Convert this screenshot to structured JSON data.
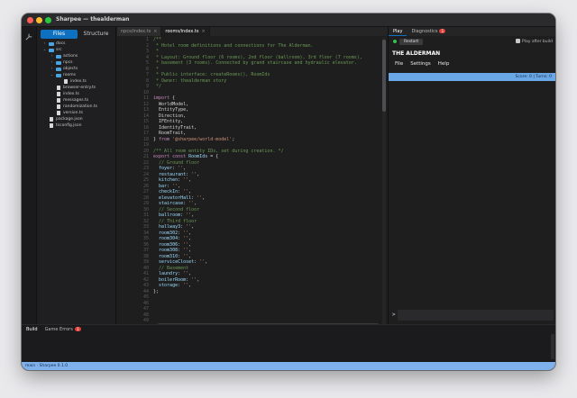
{
  "window": {
    "title": "Sharpee — thealderman"
  },
  "sidebar": {
    "tabs": [
      {
        "label": "Files"
      },
      {
        "label": "Structure"
      }
    ],
    "tree": [
      {
        "label": "docs",
        "type": "folder",
        "depth": 0,
        "expanded": false
      },
      {
        "label": "src",
        "type": "folder",
        "depth": 0,
        "expanded": true
      },
      {
        "label": "actions",
        "type": "folder",
        "depth": 1,
        "expanded": false
      },
      {
        "label": "npcs",
        "type": "folder",
        "depth": 1,
        "expanded": false
      },
      {
        "label": "objects",
        "type": "folder",
        "depth": 1,
        "expanded": false
      },
      {
        "label": "rooms",
        "type": "folder",
        "depth": 1,
        "expanded": true
      },
      {
        "label": "index.ts",
        "type": "file",
        "depth": 2
      },
      {
        "label": "browser-entry.ts",
        "type": "file",
        "depth": 1
      },
      {
        "label": "index.ts",
        "type": "file",
        "depth": 1
      },
      {
        "label": "messages.ts",
        "type": "file",
        "depth": 1
      },
      {
        "label": "randomization.ts",
        "type": "file",
        "depth": 1
      },
      {
        "label": "version.ts",
        "type": "file",
        "depth": 1
      },
      {
        "label": "package.json",
        "type": "file",
        "depth": 0
      },
      {
        "label": "tsconfig.json",
        "type": "file",
        "depth": 0
      }
    ]
  },
  "editor": {
    "tabs": [
      {
        "label": "npcs/index.ts",
        "active": false
      },
      {
        "label": "rooms/index.ts",
        "active": true
      }
    ],
    "line_numbers": [
      "1",
      "2",
      "3",
      "4",
      "5",
      "6",
      "7",
      "8",
      "9",
      "10",
      "11",
      "12",
      "13",
      "14",
      "15",
      "16",
      "17",
      "18",
      "19",
      "20",
      "21",
      "22",
      "23",
      "24",
      "25",
      "26",
      "27",
      "28",
      "29",
      "30",
      "31",
      "32",
      "33",
      "34",
      "35",
      "36",
      "37",
      "38",
      "39",
      "40",
      "41",
      "42",
      "43",
      "44",
      "45",
      "46",
      "47",
      "48",
      "49"
    ],
    "lines": [
      [
        {
          "t": "c",
          "s": "/**"
        }
      ],
      [
        {
          "t": "c",
          "s": " * Hotel room definitions and connections for The Alderman."
        }
      ],
      [
        {
          "t": "c",
          "s": " *"
        }
      ],
      [
        {
          "t": "c",
          "s": " * Layout: Ground floor (6 rooms), 2nd floor (ballroom), 3rd floor (7 rooms),"
        }
      ],
      [
        {
          "t": "c",
          "s": " * basement (3 rooms). Connected by grand staircase and hydraulic elevator."
        }
      ],
      [
        {
          "t": "c",
          "s": " *"
        }
      ],
      [
        {
          "t": "c",
          "s": " * Public interface: createRooms(), RoomIds"
        }
      ],
      [
        {
          "t": "c",
          "s": " * Owner: thealderman story"
        }
      ],
      [
        {
          "t": "c",
          "s": " */"
        }
      ],
      [],
      [
        {
          "t": "k",
          "s": "import"
        },
        {
          "t": "p",
          "s": " {"
        }
      ],
      [
        {
          "t": "p",
          "s": "  WorldModel,"
        }
      ],
      [
        {
          "t": "p",
          "s": "  EntityType,"
        }
      ],
      [
        {
          "t": "p",
          "s": "  Direction,"
        }
      ],
      [
        {
          "t": "p",
          "s": "  IFEntity,"
        }
      ],
      [
        {
          "t": "p",
          "s": "  IdentityTrait,"
        }
      ],
      [
        {
          "t": "p",
          "s": "  RoomTrait,"
        }
      ],
      [
        {
          "t": "p",
          "s": "} "
        },
        {
          "t": "k",
          "s": "from"
        },
        {
          "t": "p",
          "s": " "
        },
        {
          "t": "s",
          "s": "'@sharpee/world-model'"
        },
        {
          "t": "p",
          "s": ";"
        }
      ],
      [],
      [
        {
          "t": "c",
          "s": "/** All room entity IDs, set during creation. */"
        }
      ],
      [
        {
          "t": "k",
          "s": "export const"
        },
        {
          "t": "p",
          "s": " "
        },
        {
          "t": "i",
          "s": "RoomIds"
        },
        {
          "t": "p",
          "s": " = {"
        }
      ],
      [
        {
          "t": "c",
          "s": "  // Ground floor"
        }
      ],
      [
        {
          "t": "i",
          "s": "  foyer"
        },
        {
          "t": "p",
          "s": ": "
        },
        {
          "t": "s",
          "s": "''"
        },
        {
          "t": "p",
          "s": ","
        }
      ],
      [
        {
          "t": "i",
          "s": "  restaurant"
        },
        {
          "t": "p",
          "s": ": "
        },
        {
          "t": "s",
          "s": "''"
        },
        {
          "t": "p",
          "s": ","
        }
      ],
      [
        {
          "t": "i",
          "s": "  kitchen"
        },
        {
          "t": "p",
          "s": ": "
        },
        {
          "t": "s",
          "s": "''"
        },
        {
          "t": "p",
          "s": ","
        }
      ],
      [
        {
          "t": "i",
          "s": "  bar"
        },
        {
          "t": "p",
          "s": ": "
        },
        {
          "t": "s",
          "s": "''"
        },
        {
          "t": "p",
          "s": ","
        }
      ],
      [
        {
          "t": "i",
          "s": "  checkIn"
        },
        {
          "t": "p",
          "s": ": "
        },
        {
          "t": "s",
          "s": "''"
        },
        {
          "t": "p",
          "s": ","
        }
      ],
      [
        {
          "t": "i",
          "s": "  elevatorHall"
        },
        {
          "t": "p",
          "s": ": "
        },
        {
          "t": "s",
          "s": "''"
        },
        {
          "t": "p",
          "s": ","
        }
      ],
      [
        {
          "t": "i",
          "s": "  staircase"
        },
        {
          "t": "p",
          "s": ": "
        },
        {
          "t": "s",
          "s": "''"
        },
        {
          "t": "p",
          "s": ","
        }
      ],
      [
        {
          "t": "c",
          "s": "  // Second floor"
        }
      ],
      [
        {
          "t": "i",
          "s": "  ballroom"
        },
        {
          "t": "p",
          "s": ": "
        },
        {
          "t": "s",
          "s": "''"
        },
        {
          "t": "p",
          "s": ","
        }
      ],
      [
        {
          "t": "c",
          "s": "  // Third floor"
        }
      ],
      [
        {
          "t": "i",
          "s": "  hallway3"
        },
        {
          "t": "p",
          "s": ": "
        },
        {
          "t": "s",
          "s": "''"
        },
        {
          "t": "p",
          "s": ","
        }
      ],
      [
        {
          "t": "i",
          "s": "  room302"
        },
        {
          "t": "p",
          "s": ": "
        },
        {
          "t": "s",
          "s": "''"
        },
        {
          "t": "p",
          "s": ","
        }
      ],
      [
        {
          "t": "i",
          "s": "  room304"
        },
        {
          "t": "p",
          "s": ": "
        },
        {
          "t": "s",
          "s": "''"
        },
        {
          "t": "p",
          "s": ","
        }
      ],
      [
        {
          "t": "i",
          "s": "  room306"
        },
        {
          "t": "p",
          "s": ": "
        },
        {
          "t": "s",
          "s": "''"
        },
        {
          "t": "p",
          "s": ","
        }
      ],
      [
        {
          "t": "i",
          "s": "  room308"
        },
        {
          "t": "p",
          "s": ": "
        },
        {
          "t": "s",
          "s": "''"
        },
        {
          "t": "p",
          "s": ","
        }
      ],
      [
        {
          "t": "i",
          "s": "  room310"
        },
        {
          "t": "p",
          "s": ": "
        },
        {
          "t": "s",
          "s": "''"
        },
        {
          "t": "p",
          "s": ","
        }
      ],
      [
        {
          "t": "i",
          "s": "  serviceCloset"
        },
        {
          "t": "p",
          "s": ": "
        },
        {
          "t": "s",
          "s": "''"
        },
        {
          "t": "p",
          "s": ","
        }
      ],
      [
        {
          "t": "c",
          "s": "  // Basement"
        }
      ],
      [
        {
          "t": "i",
          "s": "  laundry"
        },
        {
          "t": "p",
          "s": ": "
        },
        {
          "t": "s",
          "s": "''"
        },
        {
          "t": "p",
          "s": ","
        }
      ],
      [
        {
          "t": "i",
          "s": "  boilerRoom"
        },
        {
          "t": "p",
          "s": ": "
        },
        {
          "t": "s",
          "s": "''"
        },
        {
          "t": "p",
          "s": ","
        }
      ],
      [
        {
          "t": "i",
          "s": "  storage"
        },
        {
          "t": "p",
          "s": ": "
        },
        {
          "t": "s",
          "s": "''"
        },
        {
          "t": "p",
          "s": ","
        }
      ],
      [
        {
          "t": "p",
          "s": "};"
        }
      ],
      [],
      [],
      [],
      [],
      []
    ]
  },
  "right_panel": {
    "tabs": [
      {
        "label": "Play",
        "active": true
      },
      {
        "label": "Diagnostics",
        "active": false,
        "badge": "1"
      }
    ],
    "restart_label": "Restart",
    "play_after_build_label": "Play after build",
    "game_title": "THE ALDERMAN",
    "menu": [
      "File",
      "Settings",
      "Help"
    ],
    "status_line": "Score: 0 | Turns: 0",
    "prompt": ">"
  },
  "bottom_panel": {
    "tabs": [
      {
        "label": "Build",
        "active": true
      },
      {
        "label": "Game Errors",
        "active": false,
        "badge": "1"
      }
    ]
  },
  "statusbar": {
    "text": "main · Sharpee 0.1.0"
  },
  "colors": {
    "accent": "#0e70c0",
    "status_bar": "#7fb2ec",
    "game_status": "#6aa7e6",
    "badge": "#e0413c",
    "comment": "#6a9955",
    "keyword": "#c586c0",
    "identifier": "#9cdcfe",
    "string": "#ce9178"
  }
}
